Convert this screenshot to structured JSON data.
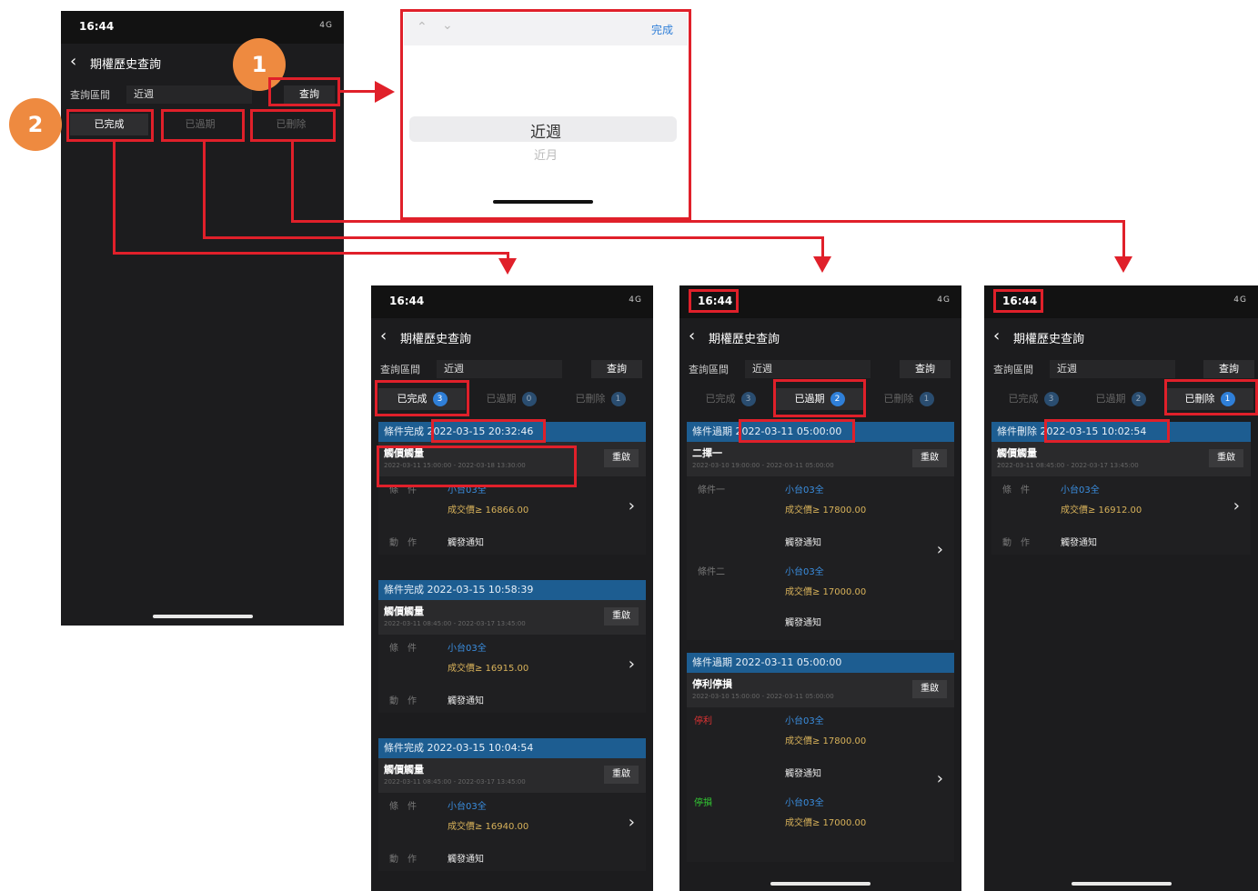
{
  "colors": {
    "accent": "#e0202a",
    "badge": "#ee8a40",
    "header_blue": "#1d5d91",
    "dot_blue": "#2f7fd8"
  },
  "badges": {
    "one": "1",
    "two": "2"
  },
  "main_phone": {
    "time": "16:44",
    "signal": "4G",
    "title": "期權歷史查詢",
    "query_label": "查詢區間",
    "query_value": "近週",
    "query_button": "查詢",
    "tabs": [
      "已完成",
      "已過期",
      "已刪除"
    ]
  },
  "picker": {
    "done": "完成",
    "selected": "近週",
    "other": "近月"
  },
  "phone_completed": {
    "time": "16:44",
    "signal": "4G",
    "title": "期權歷史查詢",
    "query_label": "查詢區間",
    "query_value": "近週",
    "query_button": "查詢",
    "tabs": [
      {
        "label": "已完成",
        "count": "3"
      },
      {
        "label": "已過期",
        "count": "0"
      },
      {
        "label": "已刪除",
        "count": "1"
      }
    ],
    "cards": [
      {
        "head": "條件完成 2022-03-15 20:32:46",
        "type": "觸價觸量",
        "range": "2022-03-11 15:00:00 - 2022-03-18 13:30:00",
        "button": "重啟",
        "cond_label": "條　件",
        "product": "小台03全",
        "price": "成交價≥ 16866.00",
        "action_label": "動　作",
        "action": "觸發通知"
      },
      {
        "head": "條件完成 2022-03-15 10:58:39",
        "type": "觸價觸量",
        "range": "2022-03-11 08:45:00 - 2022-03-17 13:45:00",
        "button": "重啟",
        "cond_label": "條　件",
        "product": "小台03全",
        "price": "成交價≥ 16915.00",
        "action_label": "動　作",
        "action": "觸發通知"
      },
      {
        "head": "條件完成 2022-03-15 10:04:54",
        "type": "觸價觸量",
        "range": "2022-03-11 08:45:00 - 2022-03-17 13:45:00",
        "button": "重啟",
        "cond_label": "條　件",
        "product": "小台03全",
        "price": "成交價≥ 16940.00",
        "action_label": "動　作",
        "action": "觸發通知"
      }
    ]
  },
  "phone_expired": {
    "time": "16:44",
    "signal": "4G",
    "title": "期權歷史查詢",
    "query_label": "查詢區間",
    "query_value": "近週",
    "query_button": "查詢",
    "tabs": [
      {
        "label": "已完成",
        "count": "3"
      },
      {
        "label": "已過期",
        "count": "2"
      },
      {
        "label": "已刪除",
        "count": "1"
      }
    ],
    "cards": [
      {
        "head": "條件過期 2022-03-11 05:00:00",
        "type": "二擇一",
        "range": "2022-03-10 19:00:00 - 2022-03-11 05:00:00",
        "button": "重啟",
        "rows": [
          {
            "lbl": "條件一",
            "product": "小台03全",
            "price": "成交價≥ 17800.00",
            "action": "觸發通知"
          },
          {
            "lbl": "條件二",
            "product": "小台03全",
            "price": "成交價≥ 17000.00",
            "action": "觸發通知"
          }
        ]
      },
      {
        "head": "條件過期 2022-03-11 05:00:00",
        "type": "停利停損",
        "range": "2022-03-10 15:00:00 - 2022-03-11 05:00:00",
        "button": "重啟",
        "rows": [
          {
            "lbl": "停利",
            "product": "小台03全",
            "price": "成交價≥ 17800.00",
            "action": "觸發通知"
          },
          {
            "lbl": "停損",
            "product": "小台03全",
            "price": "成交價≥ 17000.00",
            "action": ""
          }
        ]
      }
    ]
  },
  "phone_deleted": {
    "time": "16:44",
    "signal": "4G",
    "title": "期權歷史查詢",
    "query_label": "查詢區間",
    "query_value": "近週",
    "query_button": "查詢",
    "tabs": [
      {
        "label": "已完成",
        "count": "3"
      },
      {
        "label": "已過期",
        "count": "2"
      },
      {
        "label": "已刪除",
        "count": "1"
      }
    ],
    "cards": [
      {
        "head": "條件刪除 2022-03-15 10:02:54",
        "type": "觸價觸量",
        "range": "2022-03-11 08:45:00 - 2022-03-17 13:45:00",
        "button": "重啟",
        "cond_label": "條　件",
        "product": "小台03全",
        "price": "成交價≥ 16912.00",
        "action_label": "動　作",
        "action": "觸發通知"
      }
    ]
  }
}
